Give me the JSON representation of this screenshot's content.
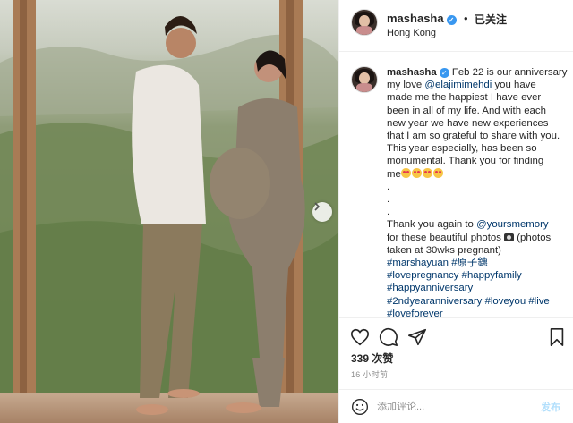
{
  "post": {
    "username": "mashasha",
    "follow_status": "已关注",
    "separator": "•",
    "location": "Hong Kong",
    "caption": {
      "username": "mashasha",
      "lines": [
        {
          "parts": [
            {
              "text": " Feb 22 is our anniversary",
              "type": "text"
            }
          ]
        },
        {
          "parts": [
            {
              "text": "my love ",
              "type": "text"
            },
            {
              "text": "@elajimimehdi",
              "type": "link"
            },
            {
              "text": " you have",
              "type": "text"
            }
          ]
        },
        {
          "parts": [
            {
              "text": "made me the happiest I have ever",
              "type": "text"
            }
          ]
        },
        {
          "parts": [
            {
              "text": "been in all of my life. And with each",
              "type": "text"
            }
          ]
        },
        {
          "parts": [
            {
              "text": "new year we have new experiences",
              "type": "text"
            }
          ]
        },
        {
          "parts": [
            {
              "text": "that I am so grateful to share with you.",
              "type": "text"
            }
          ]
        },
        {
          "parts": [
            {
              "text": "This year especially, has been so",
              "type": "text"
            }
          ]
        },
        {
          "parts": [
            {
              "text": "monumental. Thank you for finding",
              "type": "text"
            }
          ]
        },
        {
          "parts": [
            {
              "text": "me",
              "type": "text"
            },
            {
              "type": "emoji"
            },
            {
              "type": "emoji"
            },
            {
              "type": "emoji"
            },
            {
              "type": "emoji"
            }
          ]
        },
        {
          "parts": [
            {
              "text": ".",
              "type": "text"
            }
          ]
        },
        {
          "parts": [
            {
              "text": ".",
              "type": "text"
            }
          ]
        },
        {
          "parts": [
            {
              "text": ".",
              "type": "text"
            }
          ]
        },
        {
          "parts": [
            {
              "text": "Thank you again to ",
              "type": "text"
            },
            {
              "text": "@yoursmemory",
              "type": "link"
            }
          ]
        },
        {
          "parts": [
            {
              "text": "for these beautiful photos ",
              "type": "text"
            },
            {
              "type": "camera"
            },
            {
              "text": " (photos",
              "type": "text"
            }
          ]
        },
        {
          "parts": [
            {
              "text": "taken at 30wks pregnant)",
              "type": "text"
            }
          ]
        },
        {
          "parts": [
            {
              "text": "#marshayuan",
              "type": "link"
            },
            {
              "text": " ",
              "type": "text"
            },
            {
              "text": "#原子鏸",
              "type": "link"
            }
          ]
        },
        {
          "parts": [
            {
              "text": "#lovepregnancy",
              "type": "link"
            },
            {
              "text": " ",
              "type": "text"
            },
            {
              "text": "#happyfamily",
              "type": "link"
            }
          ]
        },
        {
          "parts": [
            {
              "text": "#happyanniversary",
              "type": "link"
            }
          ]
        },
        {
          "parts": [
            {
              "text": "#2ndyearanniversary",
              "type": "link"
            },
            {
              "text": " ",
              "type": "text"
            },
            {
              "text": "#loveyou",
              "type": "link"
            },
            {
              "text": " ",
              "type": "text"
            },
            {
              "text": "#live",
              "type": "link"
            }
          ]
        },
        {
          "parts": [
            {
              "text": "#loveforever",
              "type": "link"
            }
          ]
        }
      ]
    },
    "likes": "339 次赞",
    "time": "16 小时前",
    "comment_placeholder": "添加评论...",
    "post_button": "发布"
  },
  "colors": {
    "link": "#00376b",
    "verified": "#3897f0",
    "post_button_disabled": "#b2dffc",
    "secondary_text": "#8e8e8e"
  },
  "icons": [
    "verified-badge-icon",
    "heart-icon",
    "comment-icon",
    "share-icon",
    "bookmark-icon",
    "smile-icon",
    "chevron-right-icon"
  ]
}
